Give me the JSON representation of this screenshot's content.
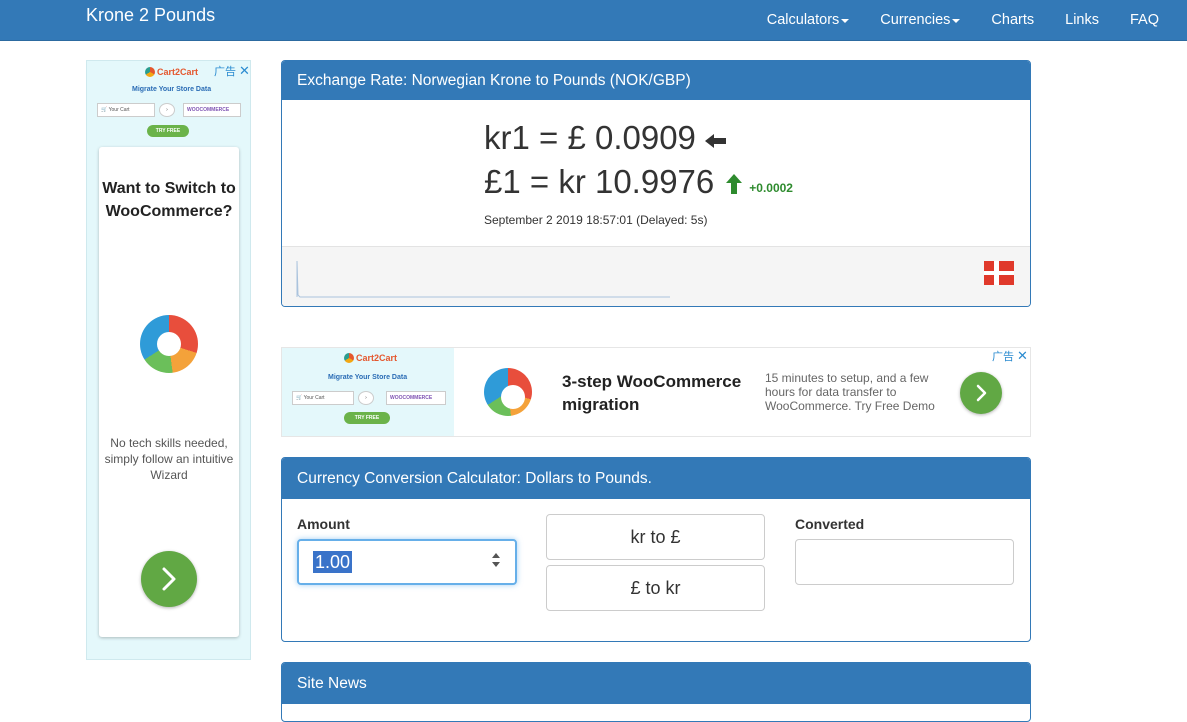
{
  "navbar": {
    "brand": "Krone 2 Pounds",
    "items": [
      {
        "label": "Calculators",
        "dropdown": true
      },
      {
        "label": "Currencies",
        "dropdown": true
      },
      {
        "label": "Charts",
        "dropdown": false
      },
      {
        "label": "Links",
        "dropdown": false
      },
      {
        "label": "FAQ",
        "dropdown": false
      }
    ]
  },
  "left_ad": {
    "ad_label": "广告",
    "banner": {
      "logo": "Cart2Cart",
      "headline": "Migrate Your Store Data",
      "source_label": "Your Cart",
      "target_label": "WOOCOMMERCE",
      "cta": "TRY FREE"
    },
    "title": "Want to Switch to WooCommerce?",
    "description": "No tech skills needed, simply follow an intuitive Wizard"
  },
  "rate_panel": {
    "heading": "Exchange Rate: Norwegian Krone to Pounds (NOK/GBP)",
    "rate1": "kr1 = £ 0.0909",
    "rate2": "£1 = kr 10.9976",
    "change": "+0.0002",
    "timestamp": "September 2 2019 18:57:01 (Delayed: 5s)"
  },
  "mid_ad": {
    "ad_label": "广告",
    "banner": {
      "logo": "Cart2Cart",
      "headline": "Migrate Your Store Data",
      "source_label": "Your Cart",
      "target_label": "WOOCOMMERCE",
      "cta": "TRY FREE"
    },
    "title_line1": "3-step WooCommerce",
    "title_line2": "migration",
    "description": "15 minutes to setup, and a few hours for data transfer to WooCommerce. Try Free Demo"
  },
  "converter": {
    "heading": "Currency Conversion Calculator: Dollars to Pounds.",
    "amount_label": "Amount",
    "amount_value": "1.00",
    "button_to_pounds": "kr to £",
    "button_to_krone": "£ to kr",
    "converted_label": "Converted",
    "converted_value": ""
  },
  "news_panel": {
    "heading": "Site News"
  },
  "colors": {
    "primary": "#3379b7",
    "up_green": "#2e8b2e",
    "ad_green": "#61a844"
  }
}
